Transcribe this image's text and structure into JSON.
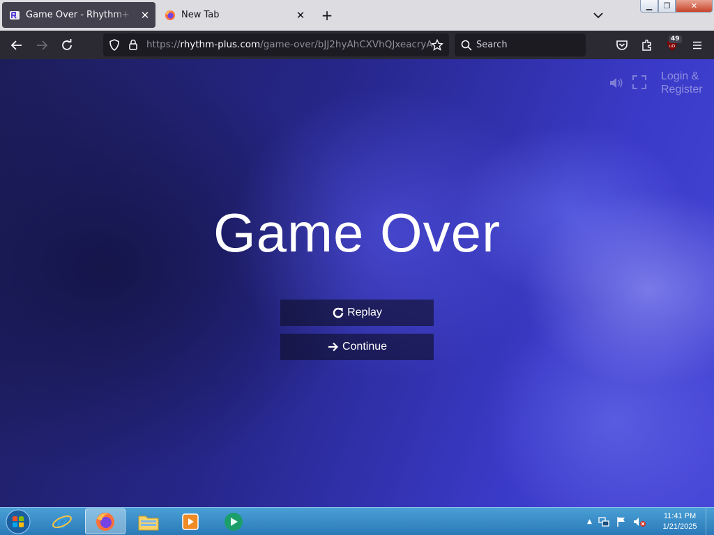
{
  "browser": {
    "tabs": [
      {
        "title": "Game Over - Rhythm+ Music Game",
        "active": true
      },
      {
        "title": "New Tab",
        "active": false
      }
    ],
    "url": {
      "scheme": "https://",
      "host": "rhythm-plus.com",
      "path": "/game-over/bJJ2hyAhCXVhQJxeacryA"
    },
    "search_placeholder": "Search",
    "extension_badge": "49"
  },
  "page": {
    "login_line1": "Login &",
    "login_line2": "Register",
    "heading": "Game Over",
    "buttons": {
      "replay": "Replay",
      "continue": "Continue"
    }
  },
  "taskbar": {
    "time": "11:41 PM",
    "date": "1/21/2025"
  },
  "colors": {
    "accent": "#3a3ac8",
    "button_bg": "#0f0f28"
  }
}
